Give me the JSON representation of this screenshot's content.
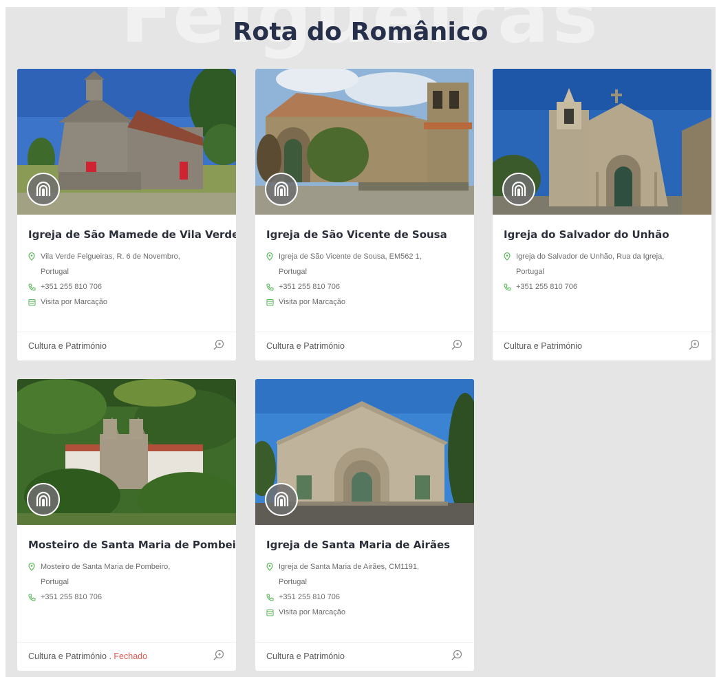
{
  "page": {
    "background_word": "Felgueiras",
    "title": "Rota do Românico"
  },
  "colors": {
    "title": "#27304a",
    "card_title": "#2b2f3a",
    "icon_green": "#5cb85c",
    "closed_red": "#e05a4f",
    "badge_bg": "#6e6e6e"
  },
  "cards": [
    {
      "title": "Igreja de São Mamede de Vila Verde",
      "address": "Vila Verde Felgueiras, R. 6 de Novembro, Portugal",
      "phone": "+351 255 810 706",
      "schedule": "Visita por Marcação",
      "category": "Cultura e Património",
      "status": "",
      "badge_icon": "romanesque-arch-icon"
    },
    {
      "title": "Igreja de São Vicente de Sousa",
      "address": "Igreja de São Vicente de Sousa, EM562 1, Portugal",
      "phone": "+351 255 810 706",
      "schedule": "Visita por Marcação",
      "category": "Cultura e Património",
      "status": "",
      "badge_icon": "romanesque-arch-icon"
    },
    {
      "title": "Igreja do Salvador do Unhão",
      "address": "Igreja do Salvador de Unhão, Rua da Igreja, Portugal",
      "phone": "+351 255 810 706",
      "schedule": "",
      "category": "Cultura e Património",
      "status": "",
      "badge_icon": "romanesque-arch-icon"
    },
    {
      "title": "Mosteiro de Santa Maria de Pombeiro",
      "address": "Mosteiro de Santa Maria de Pombeiro, Portugal",
      "phone": "+351 255 810 706",
      "schedule": "",
      "category": "Cultura e Património",
      "status_sep": ".",
      "status": "Fechado",
      "badge_icon": "romanesque-arch-icon"
    },
    {
      "title": "Igreja de Santa Maria de Airães",
      "address": "Igreja de Santa Maria de Airães, CM1191, Portugal",
      "phone": "+351 255 810 706",
      "schedule": "Visita por Marcação",
      "category": "Cultura e Património",
      "status": "",
      "badge_icon": "romanesque-arch-icon"
    }
  ],
  "icons": {
    "address": "map-pin-icon",
    "phone": "phone-icon",
    "schedule": "calendar-icon",
    "zoom": "zoom-in-icon"
  }
}
